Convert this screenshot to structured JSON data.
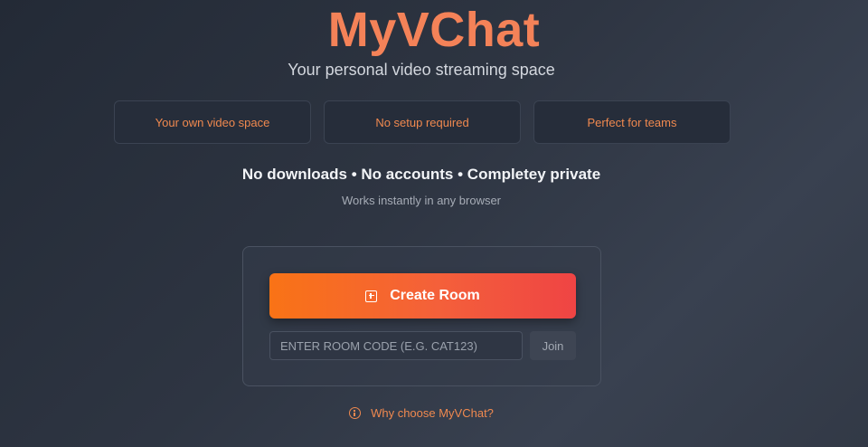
{
  "hero": {
    "title": "MyVChat",
    "subtitle": "Your personal video streaming space"
  },
  "features": [
    {
      "label": "Your own video space"
    },
    {
      "label": "No setup required"
    },
    {
      "label": "Perfect for teams"
    }
  ],
  "tagline": {
    "main": "No downloads • No accounts • Completey private",
    "sub": "Works instantly in any browser"
  },
  "room": {
    "create_label": "Create Room",
    "create_icon": "plus-square-icon",
    "code_placeholder": "ENTER ROOM CODE (E.G. CAT123)",
    "code_value": "",
    "join_label": "Join"
  },
  "footer": {
    "why_label": "Why choose MyVChat?",
    "why_icon": "info-icon"
  },
  "colors": {
    "accent": "#f48258",
    "button_gradient_start": "#f97316",
    "button_gradient_end": "#ef4444",
    "background": "#2e3542"
  }
}
